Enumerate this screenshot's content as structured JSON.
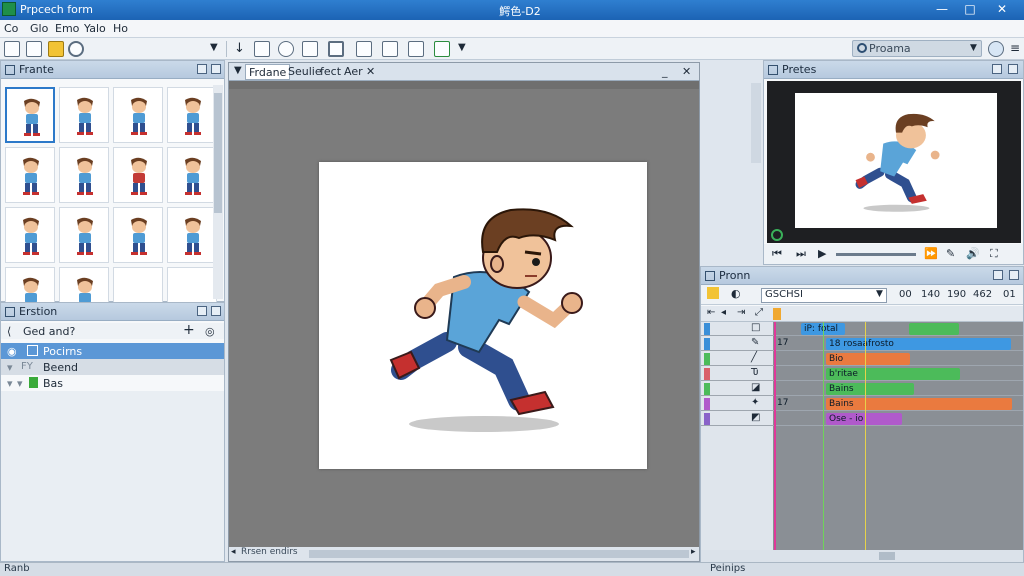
{
  "window": {
    "app_name": "Prpcech form",
    "document": "鰐色-D2"
  },
  "menu": [
    "Co",
    "Glo",
    "Emo",
    "Yalo",
    "Ho"
  ],
  "toolbar": {
    "search_placeholder": "Proama"
  },
  "frames_panel": {
    "title": "Frante"
  },
  "explorer": {
    "title": "Erstion",
    "filter": "Ged and?",
    "items": [
      {
        "label": "Pocirns",
        "selected": true
      },
      {
        "label": "Beend",
        "selected": false
      },
      {
        "label": "Bas",
        "selected": false
      }
    ]
  },
  "editor": {
    "tabs": [
      "Frdane",
      "Seulie",
      "fect",
      "Aer"
    ],
    "bottom_label": "Rrsen endirs"
  },
  "preview": {
    "title": "Pretes"
  },
  "timeline": {
    "title": "Pronn",
    "combo": "GSCHSI",
    "ruler": [
      "00",
      "140",
      "190",
      "462",
      "01"
    ],
    "layers": [
      {
        "label": "",
        "color": "#3a8fd8"
      },
      {
        "label": "17",
        "color": "#3a8fd8"
      },
      {
        "label": "",
        "color": "#4cbb5a"
      },
      {
        "label": "",
        "color": "#d95f6a"
      },
      {
        "label": "",
        "color": "#4cbb5a"
      },
      {
        "label": "17",
        "color": "#b05acb"
      },
      {
        "label": "",
        "color": "#8a63c9"
      }
    ],
    "clips": [
      {
        "label": "iP: fotal",
        "color": "#3e98e2"
      },
      {
        "label": "",
        "color": "#4cbb5a"
      },
      {
        "label": "18 rosaafrosto",
        "color": "#3e98e2"
      },
      {
        "label": "Bio",
        "color": "#ea7a3f"
      },
      {
        "label": "b'ritae",
        "color": "#4cbb5a"
      },
      {
        "label": "Bains",
        "color": "#4cbb5a"
      },
      {
        "label": "Bains",
        "color": "#ea7a3f"
      },
      {
        "label": "Ose - io",
        "color": "#b05acb"
      }
    ]
  },
  "status": {
    "left": "Ranb",
    "right": "Peinips"
  }
}
